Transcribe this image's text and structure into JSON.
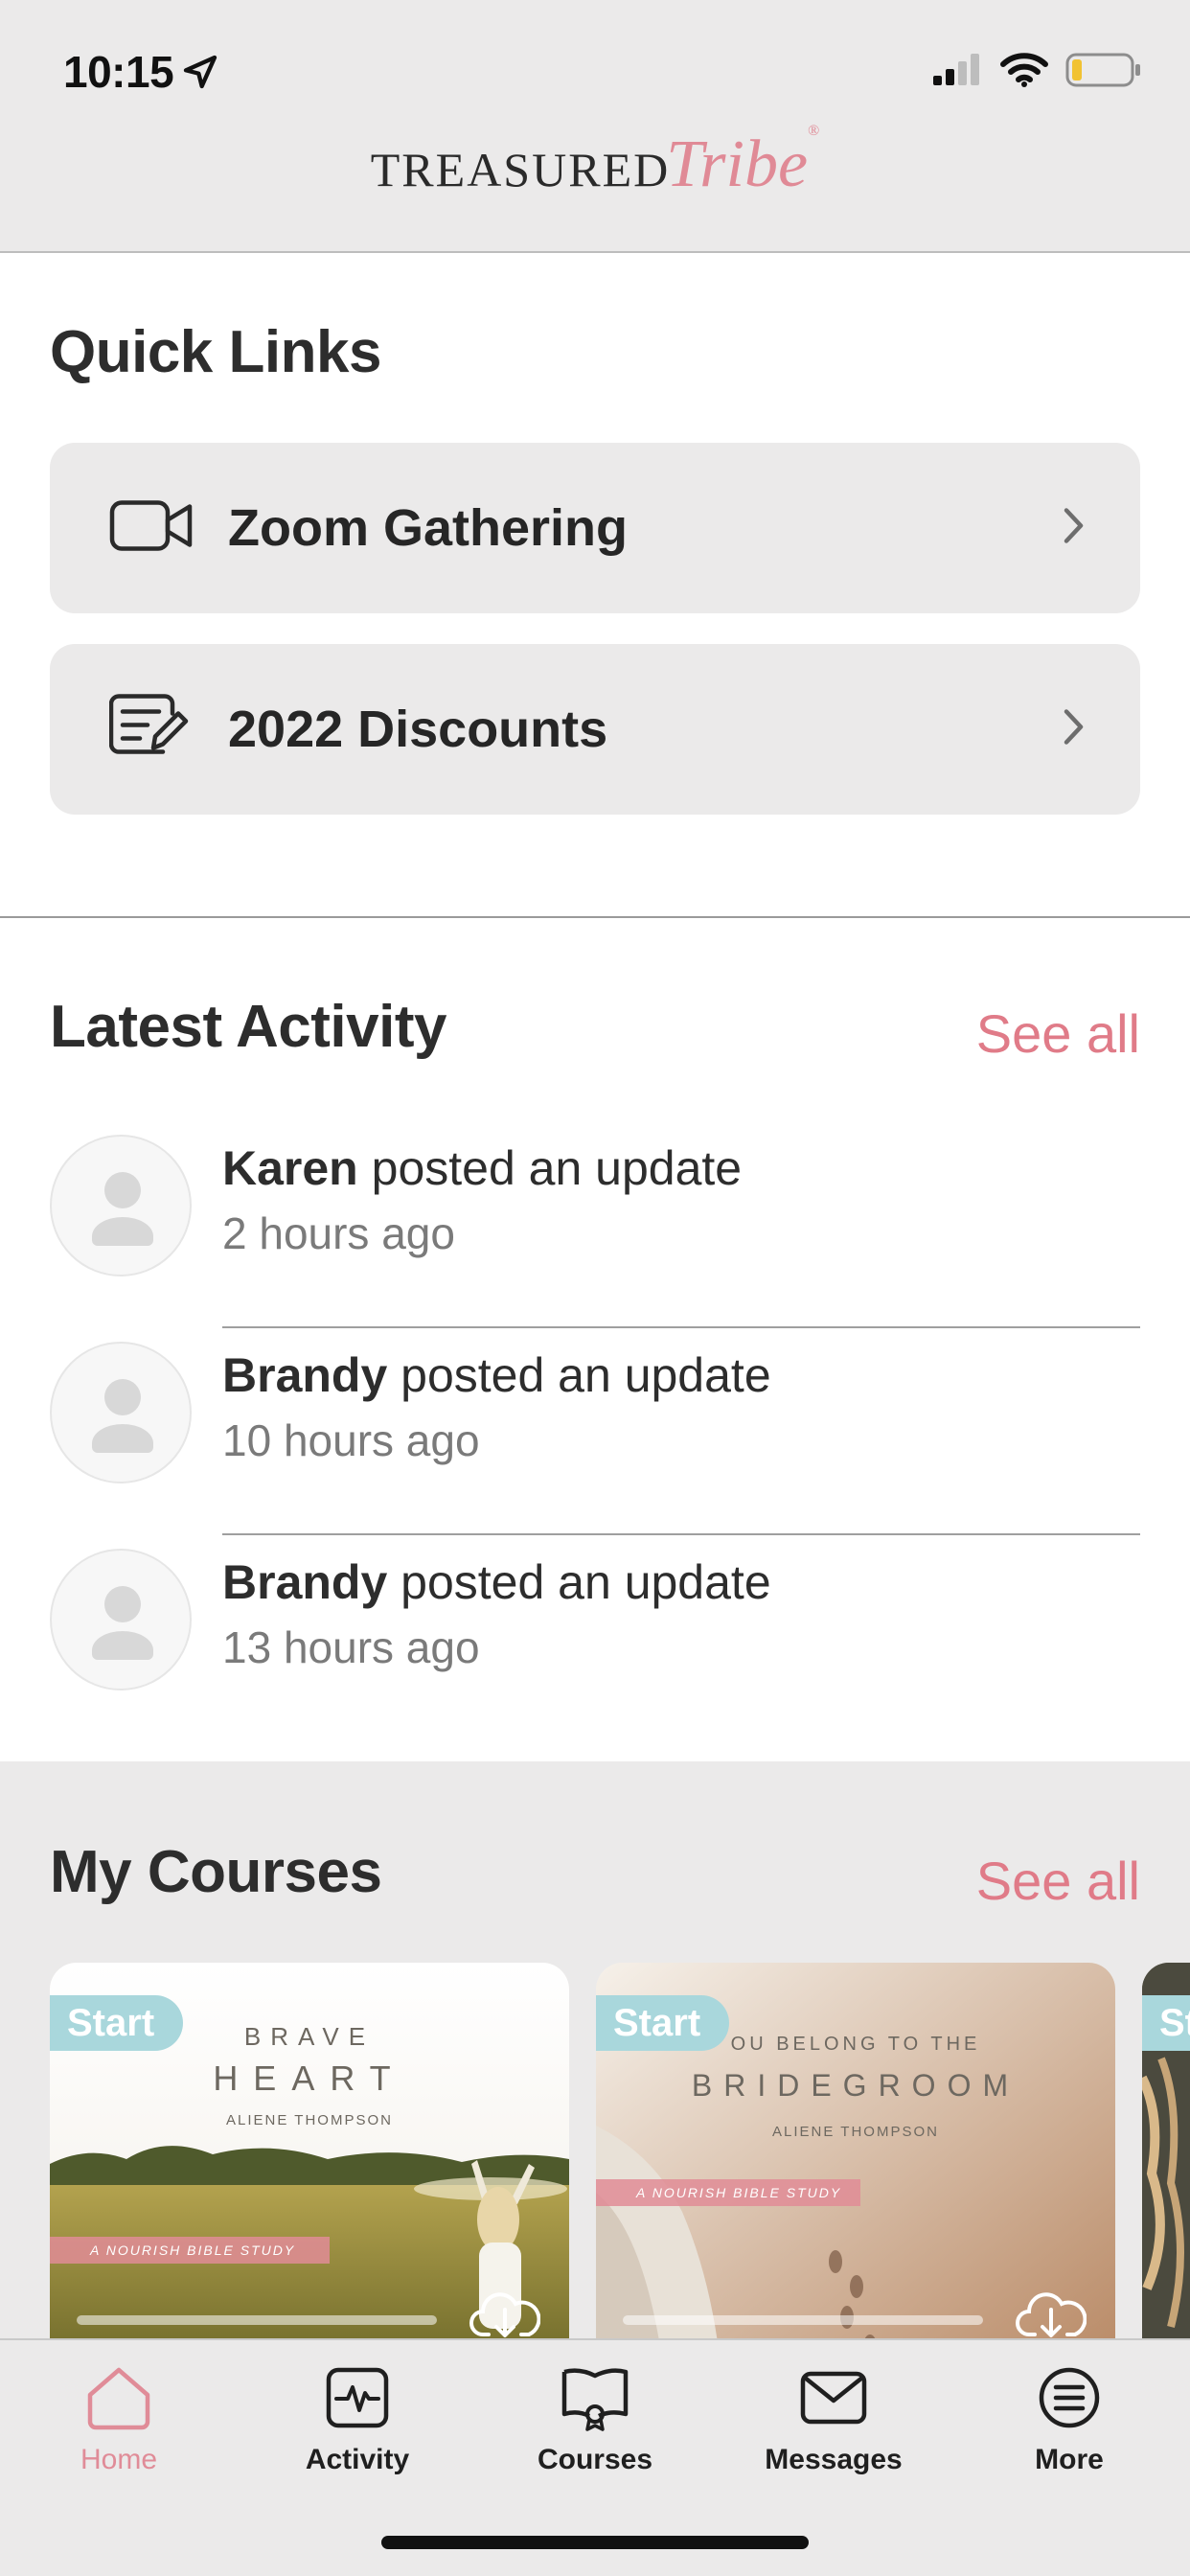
{
  "status_bar": {
    "time": "10:15"
  },
  "header": {
    "logo_word": "TREASURED",
    "logo_script": "Tribe",
    "logo_mark": "®"
  },
  "quick_links": {
    "title": "Quick Links",
    "items": [
      {
        "label": "Zoom Gathering",
        "icon": "video-camera-icon"
      },
      {
        "label": "2022 Discounts",
        "icon": "note-edit-icon"
      }
    ]
  },
  "latest_activity": {
    "title": "Latest Activity",
    "see_all": "See all",
    "items": [
      {
        "name": "Karen",
        "action": "posted an update",
        "time": "2 hours ago"
      },
      {
        "name": "Brandy",
        "action": "posted an update",
        "time": "10 hours ago"
      },
      {
        "name": "Brandy",
        "action": "posted an update",
        "time": "13 hours ago"
      }
    ]
  },
  "my_courses": {
    "title": "My Courses",
    "see_all": "See all",
    "courses": [
      {
        "badge": "Start",
        "title_line1": "BRAVE",
        "title_line2": "HEART",
        "author": "ALIENE THOMPSON",
        "band": "A NOURISH BIBLE STUDY",
        "progress": 0
      },
      {
        "badge": "Start",
        "title_line1": "OU BELONG TO THE",
        "title_line2": "BRIDEGROOM",
        "author": "ALIENE THOMPSON",
        "band": "A NOURISH BIBLE STUDY",
        "progress": 0
      },
      {
        "badge": "St"
      }
    ]
  },
  "tabbar": {
    "tabs": [
      {
        "label": "Home",
        "icon": "home-icon",
        "active": true
      },
      {
        "label": "Activity",
        "icon": "activity-icon",
        "active": false
      },
      {
        "label": "Courses",
        "icon": "courses-icon",
        "active": false
      },
      {
        "label": "Messages",
        "icon": "envelope-icon",
        "active": false
      },
      {
        "label": "More",
        "icon": "menu-list-icon",
        "active": false
      }
    ]
  },
  "colors": {
    "accent": "#e07b88",
    "badge": "#a9d7dc",
    "panel": "#ebeaea"
  }
}
